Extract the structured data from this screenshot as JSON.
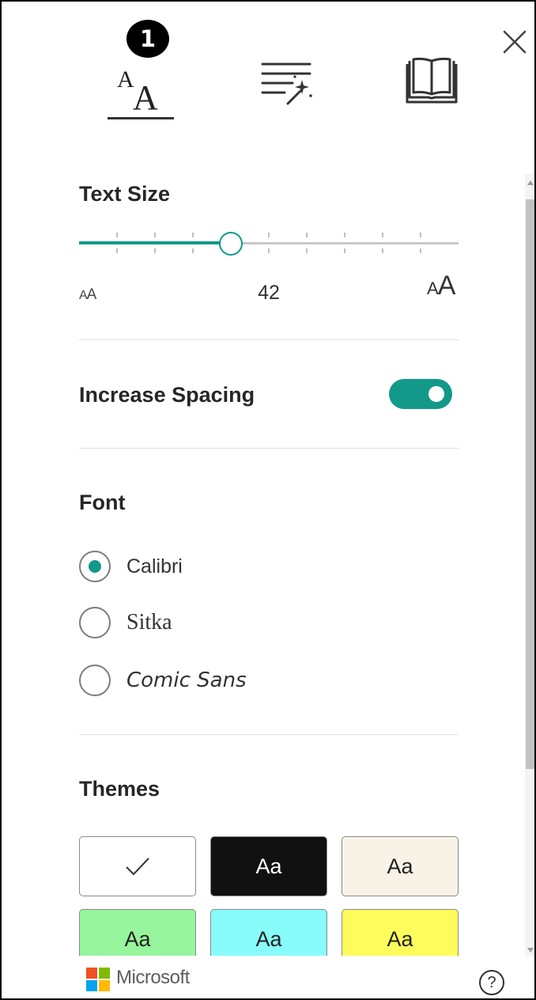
{
  "badge": {
    "number": "1"
  },
  "tabs": [
    {
      "name": "text-options",
      "icon": "text-size-icon",
      "selected": true
    },
    {
      "name": "grammar-options",
      "icon": "grammar-magic-icon",
      "selected": false
    },
    {
      "name": "reading-preferences",
      "icon": "book-icon",
      "selected": false
    }
  ],
  "text_size": {
    "label": "Text Size",
    "value": "42",
    "level_fraction": 0.4,
    "tick_count": 10,
    "small_icon": "text-size-decrease-icon",
    "large_icon": "text-size-increase-icon"
  },
  "spacing": {
    "label": "Increase Spacing",
    "on": true
  },
  "font": {
    "label": "Font",
    "options": [
      {
        "label": "Calibri",
        "checked": true
      },
      {
        "label": "Sitka",
        "checked": false
      },
      {
        "label": "Comic Sans",
        "checked": false
      }
    ]
  },
  "themes": {
    "label": "Themes",
    "swatches": [
      {
        "label": "",
        "bg": "#ffffff",
        "fg": "#222222",
        "selected": true
      },
      {
        "label": "Aa",
        "bg": "#111111",
        "fg": "#ffffff",
        "selected": false
      },
      {
        "label": "Aa",
        "bg": "#f8f3e6",
        "fg": "#222222",
        "selected": false
      },
      {
        "label": "Aa",
        "bg": "#97f59d",
        "fg": "#222222",
        "selected": false
      },
      {
        "label": "Aa",
        "bg": "#88fbfb",
        "fg": "#222222",
        "selected": false
      },
      {
        "label": "Aa",
        "bg": "#fdfc5c",
        "fg": "#222222",
        "selected": false
      }
    ]
  },
  "footer": {
    "brand": "Microsoft",
    "help_label": "?"
  },
  "colors": {
    "accent": "#12998a",
    "divider": "#e1e1e1"
  }
}
